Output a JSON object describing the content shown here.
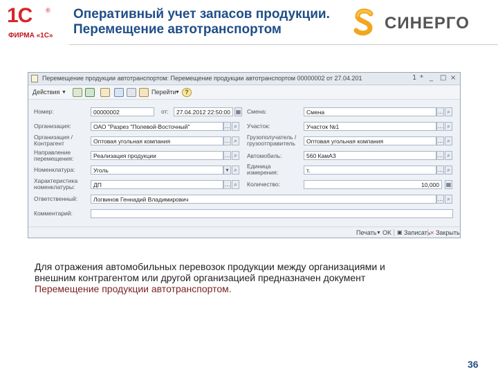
{
  "header": {
    "logo_1c_mark": "1С",
    "logo_1c_reg": "®",
    "logo_1c_text": "ФИРМА «1С»",
    "title_line1": "Оперативный учет запасов продукции.",
    "title_line2": "Перемещение автотранспортом",
    "synergy_logo_text": "СИНЕРГО"
  },
  "window": {
    "title": "Перемещение продукции автотранспортом: Перемещение продукции автотранспортом 00000002 от 27.04.201",
    "controls": [
      "1",
      "*",
      "_",
      "□",
      "×"
    ],
    "toolbar": {
      "actions_label": "Действия",
      "goto_label": "Перейти",
      "help_label": "?"
    },
    "fields": {
      "number_label": "Номер:",
      "number_value": "00000002",
      "from_label": "от:",
      "date_value": "27.04.2012 22:50:00",
      "shift_label": "Смена:",
      "shift_value": "Смена",
      "org_label": "Организация:",
      "org_value": "ОАО \"Разрез \"Полевой-Восточный\"",
      "section_label": "Участок:",
      "section_value": "Участок №1",
      "org_contractor_label_1": "Организация /",
      "org_contractor_label_2": "Контрагент",
      "org_contractor_value": "Оптовая угольная компания",
      "consignee_label_1": "Грузополучатель /",
      "consignee_label_2": "грузоотправитель",
      "consignee_value": "Оптовая угольная компания",
      "direction_label_1": "Направление",
      "direction_label_2": "перемещения:",
      "direction_value": "Реализация продукции",
      "car_label": "Автомобиль:",
      "car_value": "560 КамАЗ",
      "nomenclature_label": "Номенклатура:",
      "nomenclature_value": "Уголь",
      "unit_label_1": "Единица",
      "unit_label_2": "измерения:",
      "unit_value": "т.",
      "characteristic_label_1": "Характеристика",
      "characteristic_label_2": "номенклатуры:",
      "characteristic_value": "ДП",
      "quantity_label": "Количество:",
      "quantity_value": "10,000",
      "responsible_label": "Ответственный:",
      "responsible_value": "Логвинов Геннадий Владимирович",
      "comment_label": "Комментарий:",
      "comment_value": ""
    },
    "statusbar": {
      "print_label": "Печать",
      "ok_label": "OK",
      "save_label": "Записать",
      "close_label": "Закрыть"
    }
  },
  "caption": {
    "line1": "Для отражения автомобильных перевозок продукции между организациями и",
    "line2": "внешним контрагентом или другой организацией предназначен документ",
    "line3": "Перемещение продукции автотранспортом."
  },
  "page_number": "36",
  "colors": {
    "title": "#1f4e87",
    "logo_1c": "#d6262b",
    "synergy_mark": "#f2a61f",
    "accent_text": "#7a1f1f"
  }
}
